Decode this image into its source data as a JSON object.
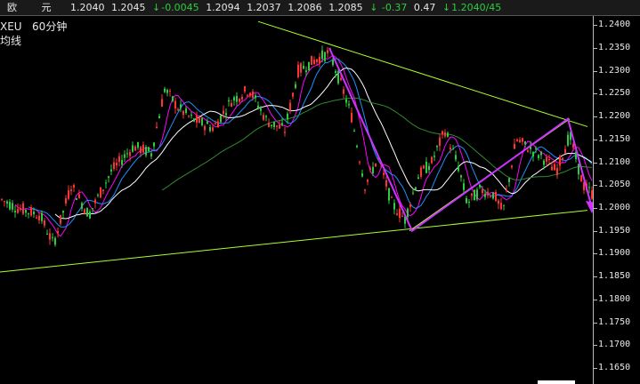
{
  "header": {
    "instrument": "欧 元",
    "last": "1.2040",
    "open": "1.2045",
    "change": "-0.0045",
    "high": "1.2094",
    "low": "1.2037",
    "prev_close": "1.2086",
    "current": "1.2085",
    "change_pct": "-0.37",
    "amplitude": "0.47",
    "bid_ask": "1.2040/45",
    "down_arrow_icon": "down-arrow-icon"
  },
  "legend": {
    "symbol": "XEU",
    "period": "60分钟",
    "line2": "均线"
  },
  "axis": {
    "ticks": [
      "1.2400",
      "1.2350",
      "1.2300",
      "1.2250",
      "1.2200",
      "1.2150",
      "1.2100",
      "1.2050",
      "1.2000",
      "1.1950",
      "1.1900",
      "1.1850",
      "1.1800",
      "1.1750",
      "1.1700",
      "1.1650"
    ]
  },
  "chart_data": {
    "type": "candlestick",
    "ylim": [
      1.1615,
      1.242
    ],
    "up_color": "#ff3333",
    "down_color": "#2ecc40",
    "ma_colors": [
      "#ffffff",
      "#ff00ff",
      "#1e90ff",
      "#2e8b2e"
    ],
    "trendline_color": "#adff2f",
    "arrow_color": "#cc33ff",
    "key_prices": [
      1.204,
      1.189,
      1.235,
      1.195,
      1.2195,
      1.1995
    ]
  }
}
